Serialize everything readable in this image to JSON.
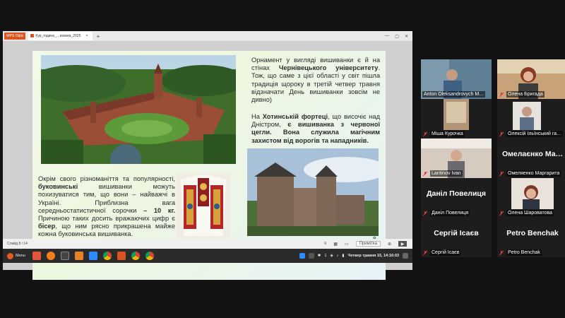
{
  "window": {
    "app_chip": "WPS Офіс",
    "tab_label": "Кур_година_…изанка_2025",
    "new_tab": "+",
    "tab_close": "×",
    "controls": [
      "—",
      "▢",
      "✕"
    ]
  },
  "slide": {
    "text1_part_a": "Орнамент у вигляді вишиванки є й на стінах ",
    "text1_bold": "Чернівецького університету",
    "text1_part_b": ". Тож, що саме з цієї області у світ пішла традиція щороку в третій четвер травня відзначати День вишиванки зовсім не дивно)",
    "text2_part_a": "На ",
    "text2_bold1": "Хотинській фортеці",
    "text2_part_b": ", що височіє над Дністром, ",
    "text2_bold2": "є вишиванка з червоної цегли. Вона служила магічним захистом від ворогів та нападників.",
    "text3_part_a": "Окрім свого різноманіття та популярності, ",
    "text3_bold1": "буковинські",
    "text3_part_b": " вишиванки можуть похизуватися тим, що вони – найважчі в Україні. Приблизна вага середньостатистичної сорочки ",
    "text3_bold2": "– 10 кг.",
    "text3_part_c": " Причиною таких досить вражаючих цифр є ",
    "text3_bold3": "бісер",
    "text3_part_d": ", що ним рясно прикрашена майже кожна буковинська вишиванка.",
    "number": "8"
  },
  "pres_footer": {
    "slide_counter": "Слайд 8 / 14",
    "notes_label": "Примітка"
  },
  "taskbar": {
    "menu_label": "Menu",
    "clock": "Четвер травня 15, 14:16:03",
    "lang": "1"
  },
  "participants": [
    {
      "name": "Anton Oleksandrovych M…",
      "big": "",
      "active": true
    },
    {
      "name": "Олена Бригада",
      "big": ""
    },
    {
      "name": "Міша Курочка",
      "big": ""
    },
    {
      "name": "Олексій Ільїнський га…",
      "big": ""
    },
    {
      "name": "Lantinov Ivan",
      "big": ""
    },
    {
      "name": "Омеляенко Маргарита",
      "big": "Омелаєнко Ма…"
    },
    {
      "name": "Даніл Повелиця",
      "big": "Даніл Повелиця"
    },
    {
      "name": "Олена Шароватова",
      "big": ""
    },
    {
      "name": "Сергій Ісаєв",
      "big": "Сергій Ісаєв"
    },
    {
      "name": "Petro Benchak",
      "big": "Petro Benchak"
    }
  ],
  "colors": {
    "active_speaker": "#2fbf71",
    "mic_off": "#e0393e",
    "wps_orange": "#d9541f"
  }
}
